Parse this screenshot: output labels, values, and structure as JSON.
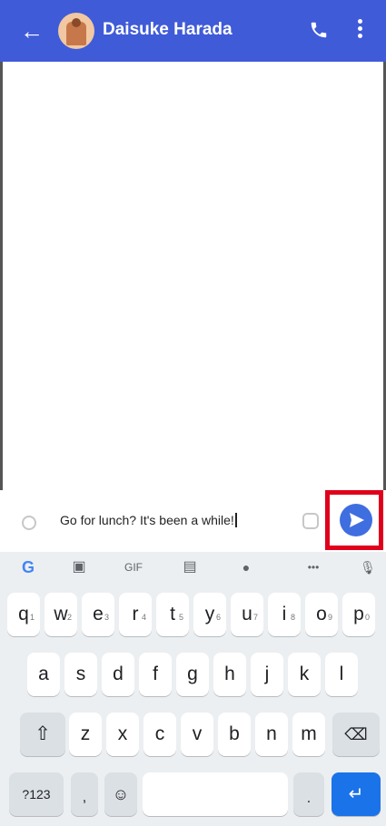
{
  "header": {
    "contact_name": "Daisuke Harada",
    "back_glyph": "←",
    "avatar_icon": "contact-avatar",
    "call_icon": "phone-icon",
    "menu_icon": "more-vert-icon"
  },
  "composer": {
    "message": "Go for lunch? It's been a while!",
    "send_icon": "send-icon",
    "highlight_color": "#e0001b",
    "accent_color": "#3f6ee0"
  },
  "keyboard_toolbar": {
    "google": "G",
    "clipboard": "▣",
    "gif": "GIF",
    "translate": "▤",
    "palette": "●",
    "more": "•••",
    "mic": "🎙"
  },
  "keyboard": {
    "row1": [
      "q",
      "w",
      "e",
      "r",
      "t",
      "y",
      "u",
      "i",
      "o",
      "p"
    ],
    "row1_hints": [
      "1",
      "2",
      "3",
      "4",
      "5",
      "6",
      "7",
      "8",
      "9",
      "0"
    ],
    "row2": [
      "a",
      "s",
      "d",
      "f",
      "g",
      "h",
      "j",
      "k",
      "l"
    ],
    "row3": [
      "z",
      "x",
      "c",
      "v",
      "b",
      "n",
      "m"
    ],
    "shift": "⇧",
    "backspace": "⌫",
    "symbols": "?123",
    "comma": ",",
    "emoji": "☺",
    "period": ".",
    "enter": "↵"
  }
}
